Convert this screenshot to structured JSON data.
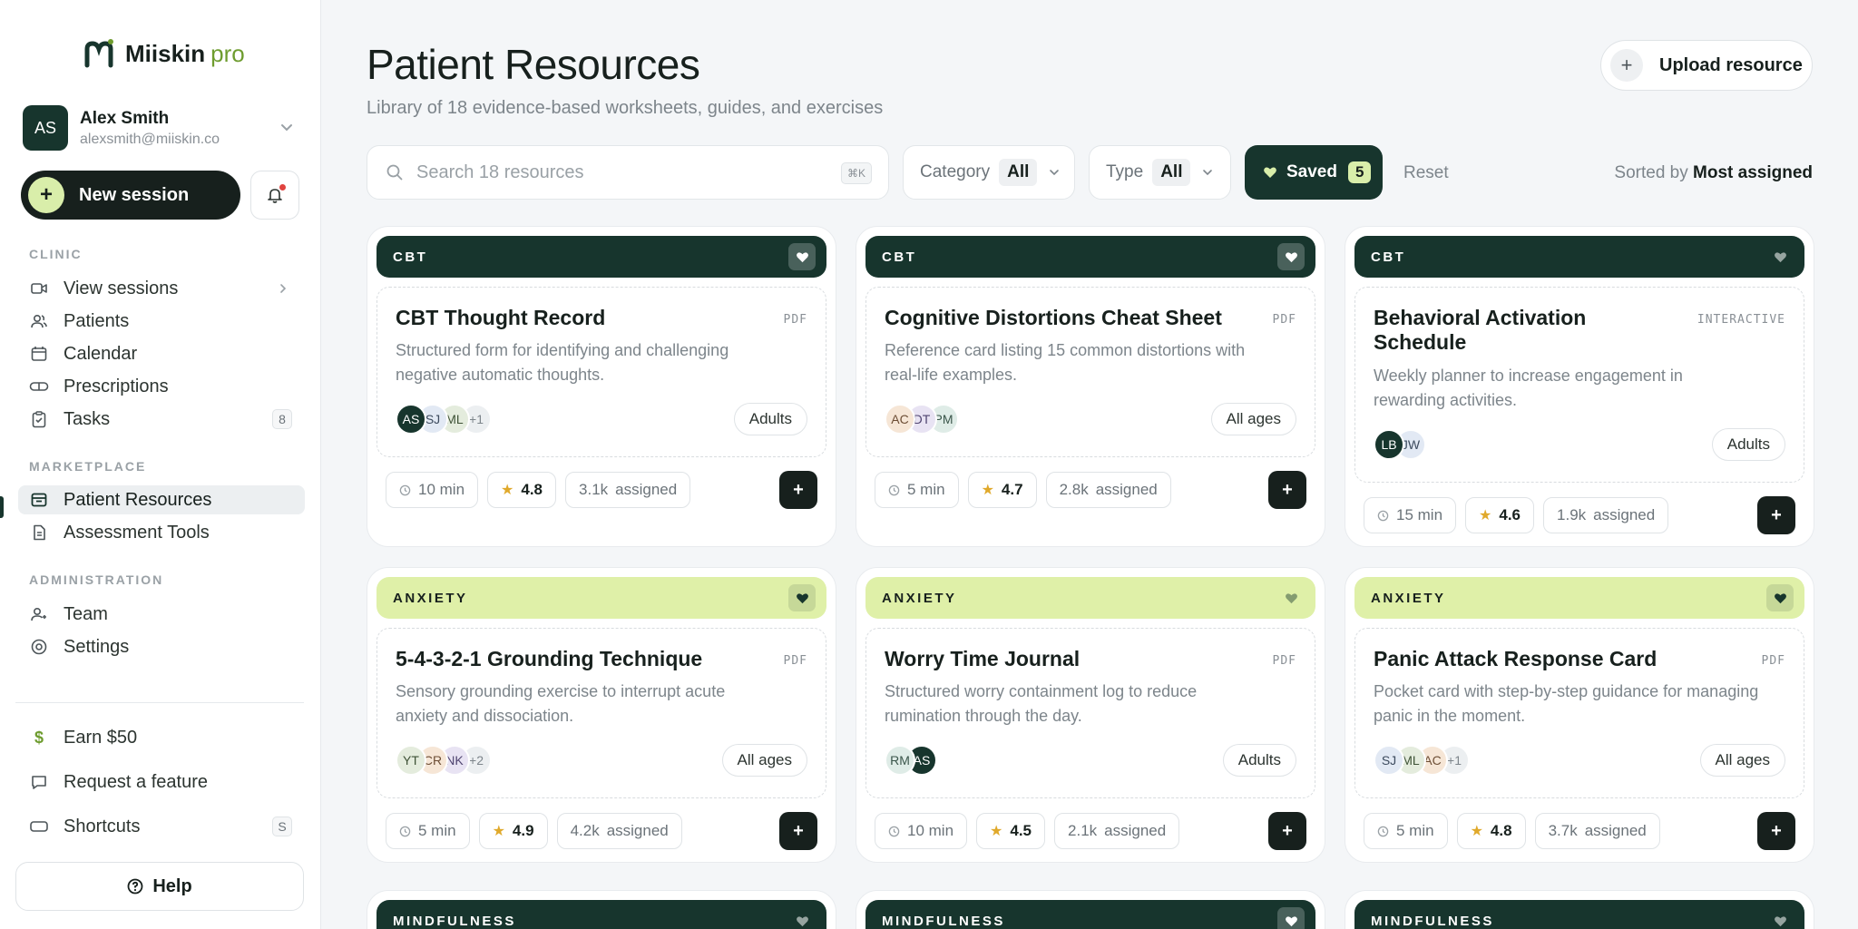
{
  "brand": {
    "name": "Miiskin",
    "suffix": "pro"
  },
  "user": {
    "initials": "AS",
    "name": "Alex Smith",
    "email": "alexsmith@miiskin.co"
  },
  "actions": {
    "new_session": "New session"
  },
  "sidebar": {
    "clinic_title": "CLINIC",
    "clinic": [
      {
        "label": "View sessions",
        "icon": "video-icon"
      },
      {
        "label": "Patients",
        "icon": "users-icon"
      },
      {
        "label": "Calendar",
        "icon": "calendar-icon"
      },
      {
        "label": "Prescriptions",
        "icon": "pill-icon"
      },
      {
        "label": "Tasks",
        "icon": "clipboard-icon",
        "badge": "8"
      }
    ],
    "marketplace_title": "MARKETPLACE",
    "marketplace": [
      {
        "label": "Patient Resources",
        "icon": "inbox-icon"
      },
      {
        "label": "Assessment Tools",
        "icon": "document-icon"
      }
    ],
    "administration_title": "ADMINISTRATION",
    "administration": [
      {
        "label": "Team",
        "icon": "team-icon"
      },
      {
        "label": "Settings",
        "icon": "settings-icon"
      }
    ],
    "footer": [
      {
        "label": "Earn $50",
        "icon": "dollar-icon"
      },
      {
        "label": "Request a feature",
        "icon": "chat-icon"
      },
      {
        "label": "Shortcuts",
        "icon": "keyboard-icon",
        "badge": "S"
      }
    ],
    "help": "Help"
  },
  "page": {
    "title": "Patient Resources",
    "subtitle": "Library of 18 evidence-based worksheets, guides, and exercises",
    "upload": "Upload resource"
  },
  "toolbar": {
    "search_placeholder": "Search 18 resources",
    "search_kbd": "⌘K",
    "category_label": "Category",
    "category_value": "All",
    "type_label": "Type",
    "type_value": "All",
    "saved_label": "Saved",
    "saved_count": "5",
    "reset": "Reset",
    "sorted_prefix": "Sorted by",
    "sorted_value": "Most assigned"
  },
  "colors": {
    "primary": "#17352d",
    "accent": "#dff0a8",
    "ink": "#17201d"
  },
  "cards": [
    {
      "category": "CBT",
      "theme": "dark",
      "saved": true,
      "title": "CBT Thought Record",
      "type": "PDF",
      "desc1": "Structured form for identifying and challenging",
      "desc2": "negative automatic thoughts.",
      "avatars": [
        "AS",
        "SJ",
        "ML",
        "+1"
      ],
      "age": "Adults",
      "time": "10 min",
      "rating": "4.8",
      "assigned": "3.1k",
      "assigned_label": "assigned"
    },
    {
      "category": "CBT",
      "theme": "dark",
      "saved": true,
      "title": "Cognitive Distortions Cheat Sheet",
      "type": "PDF",
      "desc1": "Reference card listing 15 common distortions with",
      "desc2": "real-life examples.",
      "avatars": [
        "AC",
        "DT",
        "PM"
      ],
      "age": "All ages",
      "time": "5 min",
      "rating": "4.7",
      "assigned": "2.8k",
      "assigned_label": "assigned"
    },
    {
      "category": "CBT",
      "theme": "dark",
      "saved": false,
      "title1": "Behavioral Activation",
      "title2": "Schedule",
      "type": "INTERACTIVE",
      "desc1": "Weekly planner to increase engagement in",
      "desc2": "rewarding activities.",
      "avatars": [
        "LB",
        "JW"
      ],
      "age": "Adults",
      "time": "15 min",
      "rating": "4.6",
      "assigned": "1.9k",
      "assigned_label": "assigned"
    },
    {
      "category": "ANXIETY",
      "theme": "lime",
      "saved": true,
      "title": "5-4-3-2-1 Grounding Technique",
      "type": "PDF",
      "desc1": "Sensory grounding exercise to interrupt acute",
      "desc2": "anxiety and dissociation.",
      "avatars": [
        "YT",
        "CR",
        "NK",
        "+2"
      ],
      "age": "All ages",
      "time": "5 min",
      "rating": "4.9",
      "assigned": "4.2k",
      "assigned_label": "assigned"
    },
    {
      "category": "ANXIETY",
      "theme": "lime",
      "saved": false,
      "title": "Worry Time Journal",
      "type": "PDF",
      "desc1": "Structured worry containment log to reduce",
      "desc2": "rumination through the day.",
      "avatars": [
        "RM",
        "AS"
      ],
      "age": "Adults",
      "time": "10 min",
      "rating": "4.5",
      "assigned": "2.1k",
      "assigned_label": "assigned"
    },
    {
      "category": "ANXIETY",
      "theme": "lime",
      "saved": true,
      "title": "Panic Attack Response Card",
      "type": "PDF",
      "desc1": "Pocket card with step-by-step guidance for managing",
      "desc2": "panic in the moment.",
      "avatars": [
        "SJ",
        "ML",
        "AC",
        "+1"
      ],
      "age": "All ages",
      "time": "5 min",
      "rating": "4.8",
      "assigned": "3.7k",
      "assigned_label": "assigned"
    },
    {
      "category": "MINDFULNESS",
      "theme": "dark",
      "saved": false
    },
    {
      "category": "MINDFULNESS",
      "theme": "dark",
      "saved": true
    },
    {
      "category": "MINDFULNESS",
      "theme": "dark",
      "saved": false
    }
  ]
}
